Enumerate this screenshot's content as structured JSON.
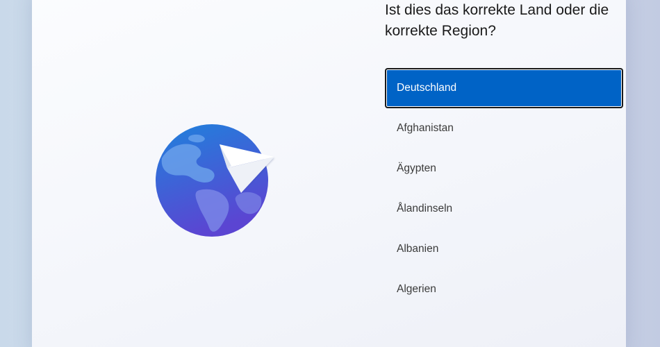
{
  "question": "Ist dies das korrekte Land oder die korrekte Region?",
  "countries": [
    {
      "label": "Deutschland",
      "selected": true
    },
    {
      "label": "Afghanistan",
      "selected": false
    },
    {
      "label": "Ägypten",
      "selected": false
    },
    {
      "label": "Ålandinseln",
      "selected": false
    },
    {
      "label": "Albanien",
      "selected": false
    },
    {
      "label": "Algerien",
      "selected": false
    }
  ],
  "colors": {
    "selection": "#0063c6",
    "globe_top": "#1f7fd8",
    "globe_bottom": "#5a48d4"
  },
  "illustration": "globe-with-paper-plane-icon"
}
